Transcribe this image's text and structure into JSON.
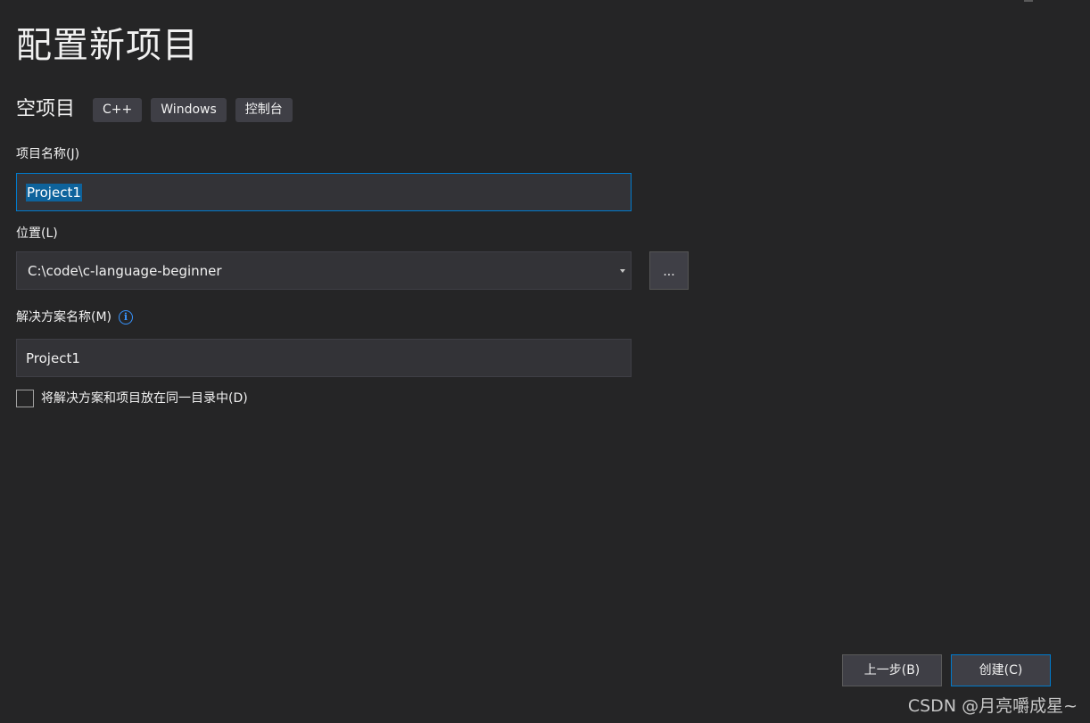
{
  "page": {
    "title": "配置新项目"
  },
  "template": {
    "name": "空项目",
    "tags": [
      "C++",
      "Windows",
      "控制台"
    ]
  },
  "project_name": {
    "label": "项目名称(J)",
    "value": "Project1"
  },
  "location": {
    "label": "位置(L)",
    "value": "C:\\code\\c-language-beginner",
    "browse_label": "..."
  },
  "solution_name": {
    "label": "解决方案名称(M)",
    "info_glyph": "i",
    "value": "Project1"
  },
  "same_directory": {
    "label": "将解决方案和项目放在同一目录中(D)",
    "checked": false
  },
  "buttons": {
    "back_label": "上一步(B)",
    "create_label": "创建(C)"
  },
  "watermark": {
    "text": "CSDN @月亮嚼成星~"
  },
  "colors": {
    "background": "#252526",
    "accent": "#007acc",
    "info_icon": "#3794ff"
  },
  "icons": {
    "info": "info-icon",
    "dropdown": "chevron-down-icon"
  }
}
